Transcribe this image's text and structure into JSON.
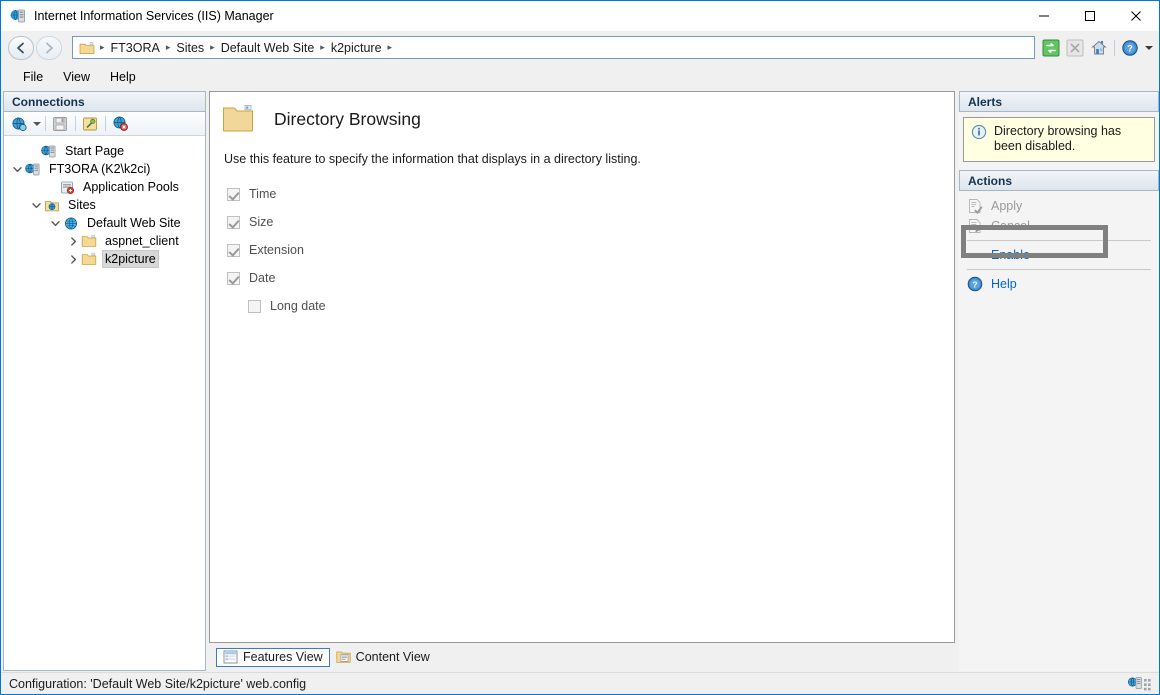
{
  "window": {
    "title": "Internet Information Services (IIS) Manager",
    "icon": "iis-server-icon",
    "minimize_label": "─",
    "maximize_label": "□",
    "close_label": "✕"
  },
  "address": {
    "back_label": "←",
    "forward_label": "→",
    "folder_icon": "folder-icon",
    "crumbs": [
      "FT3ORA",
      "Sites",
      "Default Web Site",
      "k2picture"
    ],
    "separator": "▸",
    "tools": [
      {
        "name": "refresh-icon",
        "label": "Refresh"
      },
      {
        "name": "stop-icon",
        "label": "Stop"
      },
      {
        "name": "home-icon",
        "label": "Home"
      },
      {
        "name": "help-icon",
        "label": "Help"
      }
    ]
  },
  "menubar": {
    "items": [
      "File",
      "View",
      "Help"
    ]
  },
  "connections": {
    "header": "Connections",
    "toolbar": [
      {
        "name": "connect-icon",
        "label": "Connect"
      },
      {
        "name": "save-connections-icon",
        "label": "Save Connections"
      },
      {
        "name": "connections-folder-icon",
        "label": "Connections"
      },
      {
        "name": "disconnect-icon",
        "label": "Disconnect"
      }
    ],
    "tree": [
      {
        "label": "Start Page",
        "icon": "start-page-icon",
        "expander": "",
        "depth": 0,
        "selected": false
      },
      {
        "label": "FT3ORA (K2\\k2ci)",
        "icon": "server-icon",
        "expander": "⌄",
        "depth": 0,
        "selected": false
      },
      {
        "label": "Application Pools",
        "icon": "app-pools-icon",
        "expander": "",
        "depth": 1,
        "selected": false
      },
      {
        "label": "Sites",
        "icon": "sites-icon",
        "expander": "⌄",
        "depth": 1,
        "selected": false
      },
      {
        "label": "Default Web Site",
        "icon": "web-site-icon",
        "expander": "⌄",
        "depth": 2,
        "selected": false
      },
      {
        "label": "aspnet_client",
        "icon": "folder-icon",
        "expander": "›",
        "depth": 3,
        "selected": false
      },
      {
        "label": "k2picture",
        "icon": "folder-icon",
        "expander": "›",
        "depth": 3,
        "selected": true
      }
    ]
  },
  "main": {
    "icon": "directory-browsing-icon",
    "title": "Directory Browsing",
    "description": "Use this feature to specify the information that displays in a directory listing.",
    "checkboxes": [
      {
        "label": "Time",
        "checked": true,
        "disabled": true,
        "indent": false
      },
      {
        "label": "Size",
        "checked": true,
        "disabled": true,
        "indent": false
      },
      {
        "label": "Extension",
        "checked": true,
        "disabled": true,
        "indent": false
      },
      {
        "label": "Date",
        "checked": true,
        "disabled": true,
        "indent": false
      },
      {
        "label": "Long date",
        "checked": false,
        "disabled": true,
        "indent": true
      }
    ],
    "tabs": [
      {
        "label": "Features View",
        "icon": "features-view-icon",
        "active": true
      },
      {
        "label": "Content View",
        "icon": "content-view-icon",
        "active": false
      }
    ]
  },
  "alerts": {
    "header": "Alerts",
    "icon": "info-icon",
    "message": "Directory browsing has been disabled."
  },
  "actions": {
    "header": "Actions",
    "items": [
      {
        "label": "Apply",
        "icon": "apply-icon",
        "state": "disabled",
        "highlighted": false
      },
      {
        "label": "Cancel",
        "icon": "cancel-icon",
        "state": "disabled",
        "highlighted": false
      },
      {
        "label": "Enable",
        "icon": "",
        "state": "link",
        "highlighted": true
      },
      {
        "label": "Help",
        "icon": "help-icon",
        "state": "link",
        "highlighted": false
      }
    ]
  },
  "statusbar": {
    "text": "Configuration: 'Default Web Site/k2picture' web.config",
    "icon": "server-status-icon"
  },
  "colors": {
    "accent": "#0078d7",
    "link": "#0066cc",
    "alert_bg": "#ffffe1",
    "highlight_border": "#808080",
    "pane_header_text": "#17324d"
  }
}
